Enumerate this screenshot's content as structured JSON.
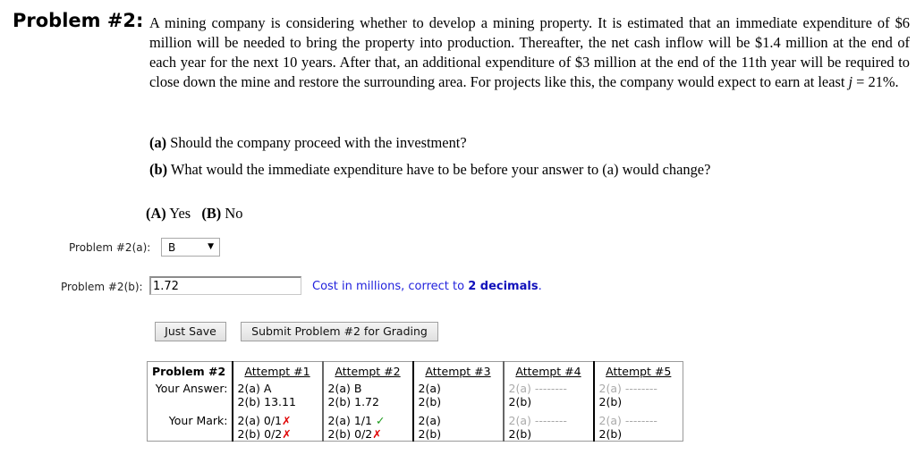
{
  "problem": {
    "heading": "Problem #2:",
    "text_before_var": "A mining company is considering whether to develop a mining property. It is estimated that an immediate expenditure of $6 million will be needed to bring the property into production. Thereafter, the net cash inflow will be $1.4 million at the end of each year for the next 10 years. After that, an additional expenditure of $3 million at the end of the 11th year will be required to close down the mine and restore the surrounding area. For projects like this, the company would expect to earn at least ",
    "variable": "j",
    "text_after_var": " = 21%."
  },
  "questions": {
    "a_label": "(a)",
    "a_text": " Should the company proceed with the investment?",
    "b_label": "(b)",
    "b_text": " What would the immediate expenditure have to be before your answer to (a) would change?"
  },
  "choices": {
    "a_label": "(A)",
    "a_text": " Yes",
    "b_label": "(B)",
    "b_text": " No"
  },
  "answer_a": {
    "label": "Problem #2(a):",
    "selected": "B",
    "arrow_icon": "▼"
  },
  "answer_b": {
    "label": "Problem #2(b):",
    "value": "1.72",
    "hint_prefix": "Cost in millions, correct to ",
    "hint_strong": "2 decimals",
    "hint_suffix": "."
  },
  "buttons": {
    "just_save": "Just Save",
    "submit": "Submit Problem #2 for Grading"
  },
  "attempts": {
    "title": "Problem #2",
    "answer_label": "Your Answer:",
    "mark_label": "Your Mark:",
    "columns": [
      {
        "header": "Attempt #1",
        "answer_a": "2(a) A",
        "answer_b": "2(b) 13.11",
        "mark_a": "2(a) 0/1",
        "mark_a_icon": "✗",
        "mark_b": "2(b) 0/2",
        "mark_b_icon": "✗"
      },
      {
        "header": "Attempt #2",
        "answer_a": "2(a) B",
        "answer_b": "2(b) 1.72",
        "mark_a": "2(a) 1/1 ",
        "mark_a_icon": "✓",
        "mark_b": "2(b) 0/2",
        "mark_b_icon": "✗"
      },
      {
        "header": "Attempt #3",
        "answer_a": "2(a)",
        "answer_b": "2(b)",
        "mark_a": "2(a)",
        "mark_b": "2(b)"
      },
      {
        "header": "Attempt #4",
        "answer_a": "2(a) --------",
        "answer_b": "2(b)",
        "mark_a": "2(a) --------",
        "mark_b": "2(b)"
      },
      {
        "header": "Attempt #5",
        "answer_a": "2(a) --------",
        "answer_b": "2(b)",
        "mark_a": "2(a) --------",
        "mark_b": "2(b)"
      }
    ]
  }
}
